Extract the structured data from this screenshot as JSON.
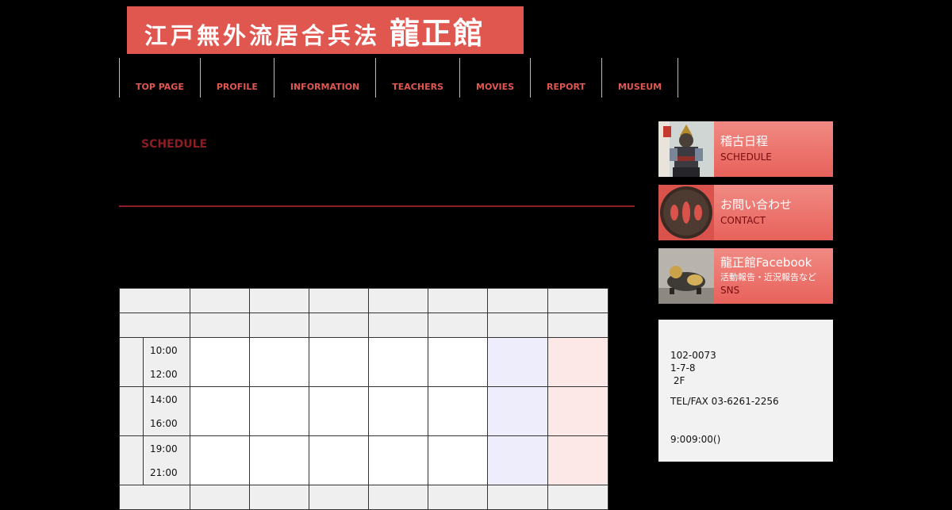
{
  "logo": {
    "text": "江戸無外流居合兵法",
    "big": "龍正館"
  },
  "nav": [
    "TOP PAGE",
    "PROFILE",
    "INFORMATION",
    "TEACHERS",
    "MOVIES",
    "REPORT",
    "MUSEUM"
  ],
  "page_title": "SCHEDULE",
  "schedule": {
    "slots": [
      {
        "start": "10:00",
        "end": "12:00"
      },
      {
        "start": "14:00",
        "end": "16:00"
      },
      {
        "start": "19:00",
        "end": "21:00"
      }
    ]
  },
  "sidebar": {
    "banners": [
      {
        "title": "稽古日程",
        "sub": "SCHEDULE"
      },
      {
        "title": "お問い合わせ",
        "sub": "CONTACT"
      },
      {
        "title": "龍正館Facebook",
        "sub": "活動報告・近況報告など",
        "sub2": "SNS"
      }
    ],
    "info": {
      "postal": "102-0073",
      "address": "1-7-8",
      "floor": " 2F",
      "tel": "TEL/FAX 03-6261-2256",
      "hours": "9:009:00()"
    }
  },
  "colors": {
    "accent": "#e05750",
    "dark_red": "#8e1c24",
    "saturday": "#ededfc",
    "sunday": "#fde8e8"
  }
}
